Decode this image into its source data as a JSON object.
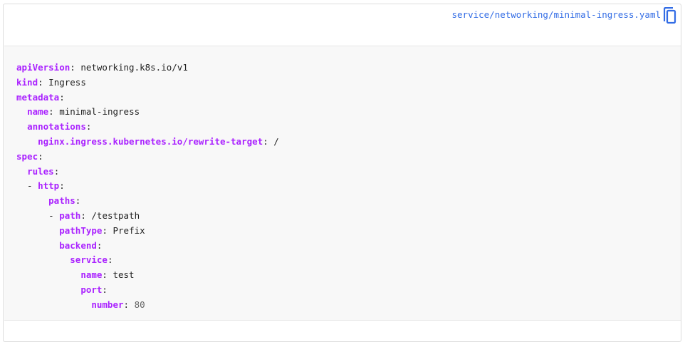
{
  "file": {
    "path": "service/networking/minimal-ingress.yaml",
    "copy_icon": "copy-icon"
  },
  "colors": {
    "key": "#aa22ff",
    "link": "#326ce5",
    "code_bg": "#f8f8f8",
    "number": "#666666"
  },
  "code": {
    "lines": [
      {
        "indent": "",
        "dash": "",
        "key": "apiVersion",
        "sep": ": ",
        "value": "networking.k8s.io/v1",
        "value_type": "text"
      },
      {
        "indent": "",
        "dash": "",
        "key": "kind",
        "sep": ": ",
        "value": "Ingress",
        "value_type": "text"
      },
      {
        "indent": "",
        "dash": "",
        "key": "metadata",
        "sep": ":",
        "value": "",
        "value_type": "text"
      },
      {
        "indent": "  ",
        "dash": "",
        "key": "name",
        "sep": ": ",
        "value": "minimal-ingress",
        "value_type": "text"
      },
      {
        "indent": "  ",
        "dash": "",
        "key": "annotations",
        "sep": ":",
        "value": "",
        "value_type": "text"
      },
      {
        "indent": "    ",
        "dash": "",
        "key": "nginx.ingress.kubernetes.io/rewrite-target",
        "sep": ": ",
        "value": "/",
        "value_type": "text"
      },
      {
        "indent": "",
        "dash": "",
        "key": "spec",
        "sep": ":",
        "value": "",
        "value_type": "text"
      },
      {
        "indent": "  ",
        "dash": "",
        "key": "rules",
        "sep": ":",
        "value": "",
        "value_type": "text"
      },
      {
        "indent": "  ",
        "dash": "- ",
        "key": "http",
        "sep": ":",
        "value": "",
        "value_type": "text"
      },
      {
        "indent": "      ",
        "dash": "",
        "key": "paths",
        "sep": ":",
        "value": "",
        "value_type": "text"
      },
      {
        "indent": "      ",
        "dash": "- ",
        "key": "path",
        "sep": ": ",
        "value": "/testpath",
        "value_type": "text"
      },
      {
        "indent": "        ",
        "dash": "",
        "key": "pathType",
        "sep": ": ",
        "value": "Prefix",
        "value_type": "text"
      },
      {
        "indent": "        ",
        "dash": "",
        "key": "backend",
        "sep": ":",
        "value": "",
        "value_type": "text"
      },
      {
        "indent": "          ",
        "dash": "",
        "key": "service",
        "sep": ":",
        "value": "",
        "value_type": "text"
      },
      {
        "indent": "            ",
        "dash": "",
        "key": "name",
        "sep": ": ",
        "value": "test",
        "value_type": "text"
      },
      {
        "indent": "            ",
        "dash": "",
        "key": "port",
        "sep": ":",
        "value": "",
        "value_type": "text"
      },
      {
        "indent": "              ",
        "dash": "",
        "key": "number",
        "sep": ": ",
        "value": "80",
        "value_type": "number"
      }
    ]
  }
}
